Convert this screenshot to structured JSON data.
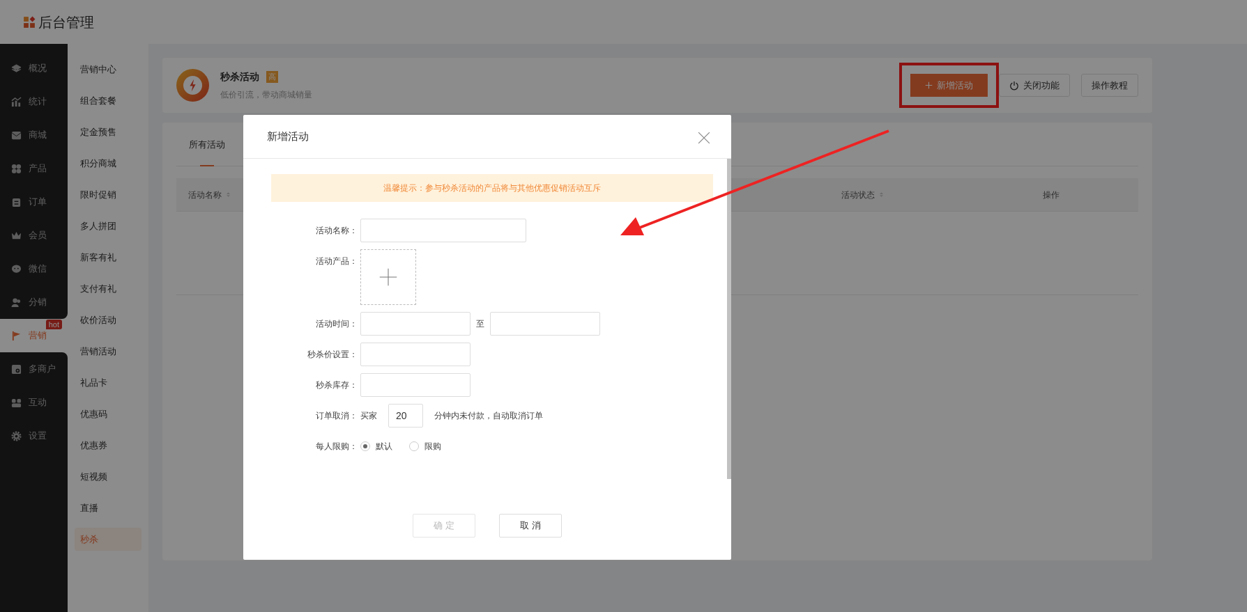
{
  "header": {
    "title": "后台管理"
  },
  "nav": [
    {
      "label": "概况",
      "selected": false
    },
    {
      "label": "统计",
      "selected": false
    },
    {
      "label": "商城",
      "selected": false
    },
    {
      "label": "产品",
      "selected": false
    },
    {
      "label": "订单",
      "selected": false
    },
    {
      "label": "会员",
      "selected": false
    },
    {
      "label": "微信",
      "selected": false
    },
    {
      "label": "分销",
      "selected": false
    },
    {
      "label": "营销",
      "selected": true,
      "badge": "hot"
    },
    {
      "label": "多商户",
      "selected": false
    },
    {
      "label": "互动",
      "selected": false
    },
    {
      "label": "设置",
      "selected": false
    }
  ],
  "subnav": [
    {
      "label": "营销中心",
      "selected": false
    },
    {
      "label": "组合套餐",
      "selected": false
    },
    {
      "label": "定金预售",
      "selected": false
    },
    {
      "label": "积分商城",
      "selected": false
    },
    {
      "label": "限时促销",
      "selected": false
    },
    {
      "label": "多人拼团",
      "selected": false
    },
    {
      "label": "新客有礼",
      "selected": false
    },
    {
      "label": "支付有礼",
      "selected": false
    },
    {
      "label": "砍价活动",
      "selected": false
    },
    {
      "label": "营销活动",
      "selected": false
    },
    {
      "label": "礼品卡",
      "selected": false
    },
    {
      "label": "优惠码",
      "selected": false
    },
    {
      "label": "优惠券",
      "selected": false
    },
    {
      "label": "短视频",
      "selected": false
    },
    {
      "label": "直播",
      "selected": false
    },
    {
      "label": "秒杀",
      "selected": true
    }
  ],
  "feature": {
    "title": "秒杀活动",
    "tag": "高",
    "subtitle": "低价引流，带动商城销量",
    "buttons": [
      {
        "label": "新增活动",
        "kind": "add",
        "highlighted": true
      },
      {
        "label": "关闭功能",
        "kind": "power",
        "highlighted": false
      },
      {
        "label": "操作教程",
        "kind": "plain",
        "highlighted": false
      }
    ]
  },
  "tabs": [
    {
      "label": "所有活动",
      "selected": true
    }
  ],
  "table": {
    "columns": [
      {
        "label": "活动名称",
        "sortable": true
      },
      {
        "label": "活动状态",
        "sortable": true
      },
      {
        "label": "操作",
        "sortable": false
      }
    ]
  },
  "dialog": {
    "title": "新增活动",
    "notice": "温馨提示：参与秒杀活动的产品将与其他优惠促销活动互斥",
    "fields": [
      {
        "kind": "text",
        "label": "活动名称："
      },
      {
        "kind": "upload",
        "label": "活动产品："
      },
      {
        "kind": "range",
        "label": "活动时间：",
        "separator": "至"
      },
      {
        "kind": "short",
        "label": "秒杀价设置："
      },
      {
        "kind": "short",
        "label": "秒杀库存："
      },
      {
        "kind": "inline",
        "label": "订单取消：",
        "prefix": "买家",
        "value": "20",
        "suffix": "分钟内未付款，自动取消订单"
      },
      {
        "kind": "radio",
        "label": "每人限购：",
        "options": [
          {
            "label": "默认",
            "selected": true
          },
          {
            "label": "限购",
            "selected": false
          }
        ]
      }
    ],
    "buttons": [
      {
        "label": "确 定",
        "disabled": true
      },
      {
        "label": "取 消",
        "disabled": false
      }
    ]
  }
}
